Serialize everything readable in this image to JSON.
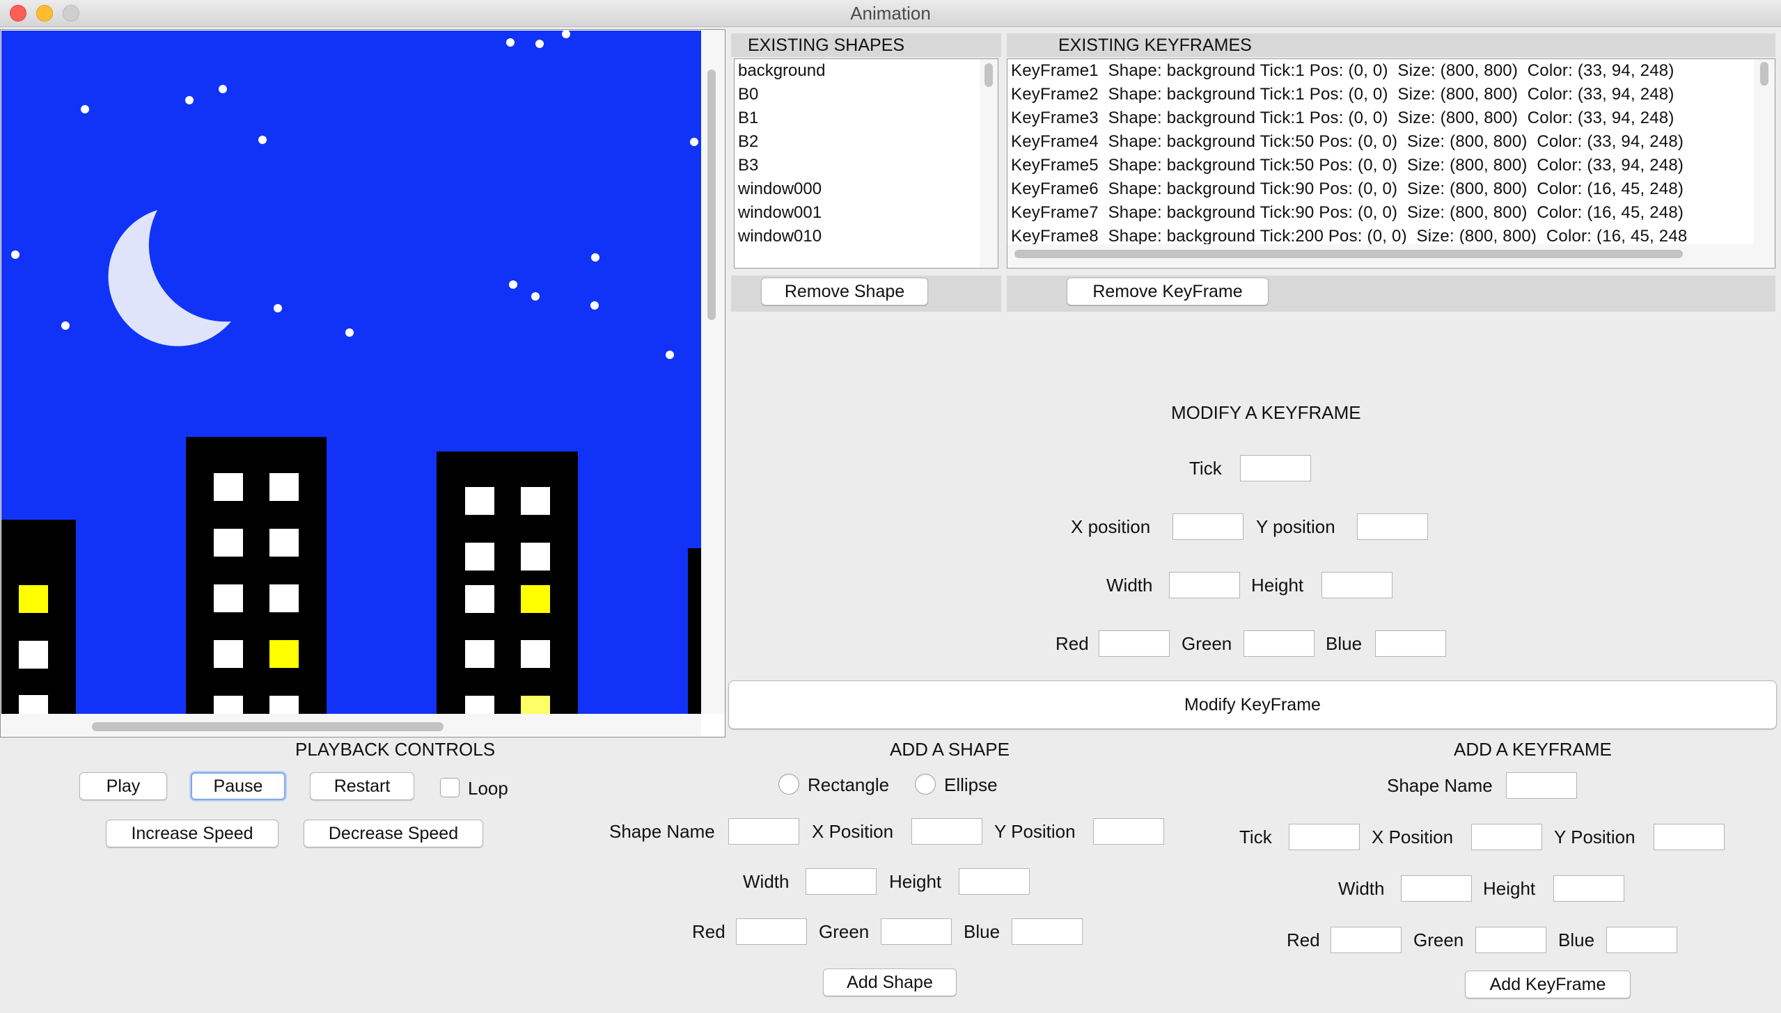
{
  "window": {
    "title": "Animation"
  },
  "colors": {
    "sky": "#1133f8",
    "building": "#000000",
    "window_white": "#ffffff",
    "window_yellow": "#ffff00",
    "window_light_yellow": "#ffff66",
    "moon": "#dfe4fa",
    "star": "#ffffff"
  },
  "shapes_panel": {
    "header": "EXISTING SHAPES",
    "items": [
      "background",
      "B0",
      "B1",
      "B2",
      "B3",
      "window000",
      "window001",
      "window010"
    ],
    "remove_label": "Remove Shape"
  },
  "keyframes_panel": {
    "header": "EXISTING KEYFRAMES",
    "items": [
      "KeyFrame1  Shape: background Tick:1 Pos: (0, 0)  Size: (800, 800)  Color: (33, 94, 248)",
      "KeyFrame2  Shape: background Tick:1 Pos: (0, 0)  Size: (800, 800)  Color: (33, 94, 248)",
      "KeyFrame3  Shape: background Tick:1 Pos: (0, 0)  Size: (800, 800)  Color: (33, 94, 248)",
      "KeyFrame4  Shape: background Tick:50 Pos: (0, 0)  Size: (800, 800)  Color: (33, 94, 248)",
      "KeyFrame5  Shape: background Tick:50 Pos: (0, 0)  Size: (800, 800)  Color: (33, 94, 248)",
      "KeyFrame6  Shape: background Tick:90 Pos: (0, 0)  Size: (800, 800)  Color: (16, 45, 248)",
      "KeyFrame7  Shape: background Tick:90 Pos: (0, 0)  Size: (800, 800)  Color: (16, 45, 248)",
      "KeyFrame8  Shape: background Tick:200 Pos: (0, 0)  Size: (800, 800)  Color: (16, 45, 248"
    ],
    "remove_label": "Remove KeyFrame"
  },
  "modify_keyframe": {
    "heading": "MODIFY A KEYFRAME",
    "tick_label": "Tick",
    "x_label": "X position",
    "y_label": "Y position",
    "width_label": "Width",
    "height_label": "Height",
    "red_label": "Red",
    "green_label": "Green",
    "blue_label": "Blue",
    "button_label": "Modify KeyFrame"
  },
  "playback": {
    "heading": "PLAYBACK CONTROLS",
    "play_label": "Play",
    "pause_label": "Pause",
    "restart_label": "Restart",
    "loop_label": "Loop",
    "loop_checked": false,
    "increase_label": "Increase Speed",
    "decrease_label": "Decrease Speed"
  },
  "add_shape": {
    "heading": "ADD A SHAPE",
    "rectangle_label": "Rectangle",
    "ellipse_label": "Ellipse",
    "name_label": "Shape Name",
    "x_label": "X Position",
    "y_label": "Y Position",
    "width_label": "Width",
    "height_label": "Height",
    "red_label": "Red",
    "green_label": "Green",
    "blue_label": "Blue",
    "button_label": "Add Shape"
  },
  "add_keyframe": {
    "heading": "ADD A KEYFRAME",
    "name_label": "Shape Name",
    "tick_label": "Tick",
    "x_label": "X Position",
    "y_label": "Y Position",
    "width_label": "Width",
    "height_label": "Height",
    "red_label": "Red",
    "green_label": "Green",
    "blue_label": "Blue",
    "button_label": "Add KeyFrame"
  }
}
